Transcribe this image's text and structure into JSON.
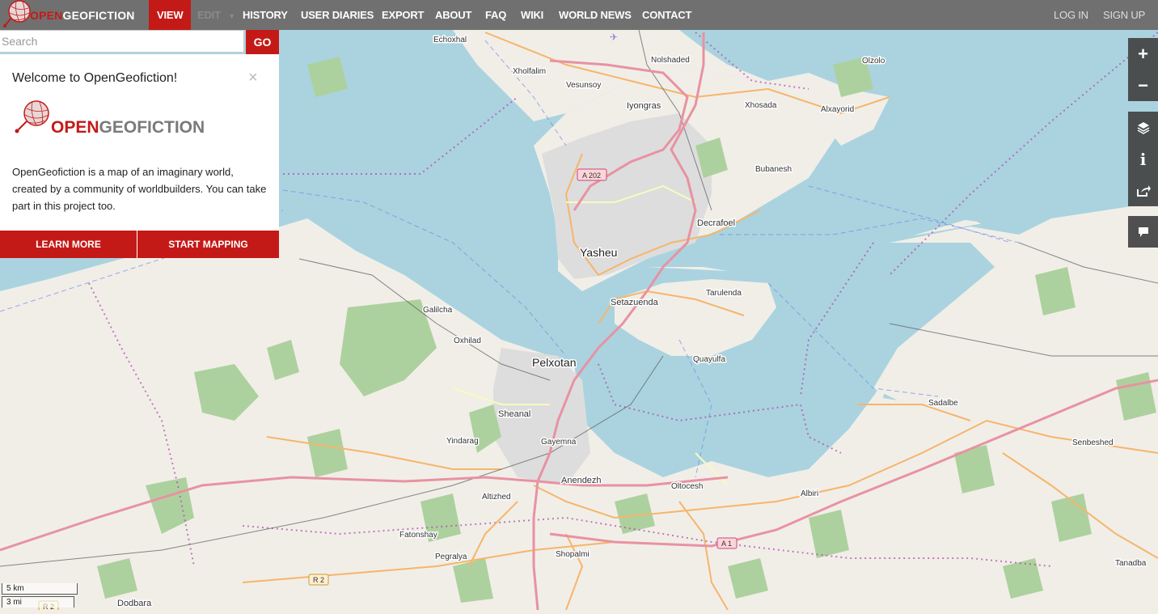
{
  "header": {
    "logo": {
      "red": "OPEN",
      "rest": "GEOFICTION"
    },
    "nav": {
      "view": "VIEW",
      "edit": "EDIT",
      "history": "HISTORY",
      "user_diaries": "USER DIARIES",
      "export": "EXPORT",
      "about": "ABOUT",
      "faq": "FAQ",
      "wiki": "WIKI",
      "world_news": "WORLD NEWS",
      "contact": "CONTACT"
    },
    "login": "LOG IN",
    "signup": "SIGN UP"
  },
  "search": {
    "placeholder": "Search",
    "value": "",
    "go": "GO"
  },
  "welcome": {
    "title": "Welcome to OpenGeofiction!",
    "logo": {
      "red": "OPEN",
      "rest": "GEOFICTION"
    },
    "body": "OpenGeofiction is a map of an imaginary world, created by a community of worldbuilders. You can take part in this project too.",
    "learn_more": "LEARN MORE",
    "start_mapping": "START MAPPING"
  },
  "map_controls": [
    "zoom-in",
    "zoom-out",
    "layers",
    "map-key",
    "share",
    "note"
  ],
  "scale": {
    "metric": "5 km",
    "imperial": "3 mi"
  },
  "road_shields": [
    "A 202",
    "A 1",
    "R 2",
    "R 2"
  ],
  "places": [
    "Echoxhal",
    "Nolshaded",
    "Olzolo",
    "Xholfalim",
    "Vesunsoy",
    "Iyongras",
    "Xhosada",
    "Alxayorid",
    "Bubanesh",
    "Decrafoel",
    "Yasheu",
    "Setazuenda",
    "Tarulenda",
    "Galilcha",
    "Oxhilad",
    "Quayulfa",
    "Pelxotan",
    "Sheanal",
    "Yindarag",
    "Gayemna",
    "Sadalbe",
    "Senbeshed",
    "Anendezh",
    "Altizhed",
    "Oltocesh",
    "Albiri",
    "Fatonshay",
    "Pegralya",
    "Shopalmi",
    "Tanadba",
    "Dodbara"
  ],
  "colors": {
    "brand": "#c41a17",
    "water": "#aad3df",
    "land": "#f1eee8",
    "forest": "#add19e",
    "motorway": "#e892a2",
    "primary": "#fcd6a4",
    "border": "#ac46ac",
    "topbar": "#707070"
  }
}
